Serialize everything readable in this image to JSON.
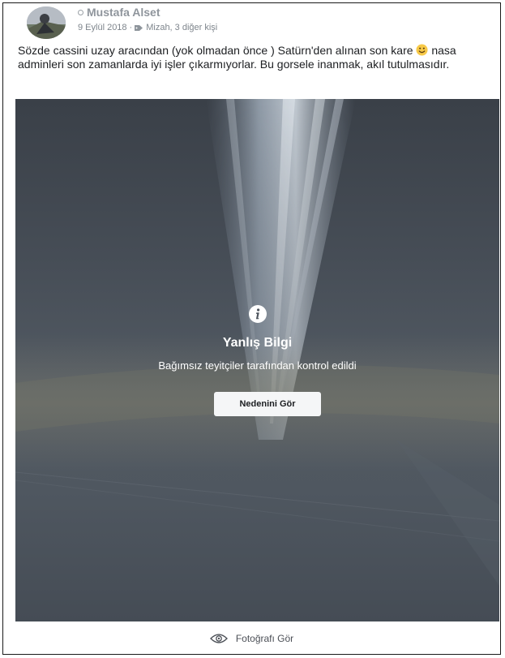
{
  "post": {
    "author": "Mustafa Alset",
    "date": "9 Eylül 2018",
    "separator": "·",
    "tags": "Mizah, 3 diğer kişi",
    "caption_part1": "Sözde cassini uzay aracından (yok olmadan önce ) Satürn'den alınan son kare",
    "caption_part2": "nasa adminleri son zamanlarda iyi işler çıkarmıyorlar. Bu gorsele inanmak, akıl tutulmasıdır."
  },
  "warning": {
    "title": "Yanlış Bilgi",
    "subtitle": "Bağımsız teyitçiler tarafından kontrol edildi",
    "button_label": "Nedenini Gör"
  },
  "footer": {
    "view_photo_label": "Fotoğrafı Gör"
  },
  "icons": {
    "privacy": "globe-icon",
    "tag": "tag-icon",
    "emoji": "smile-emoji-icon",
    "info": "info-icon",
    "eye": "eye-icon"
  },
  "colors": {
    "overlay_text": "#ffffff",
    "button_bg": "#f5f6f7",
    "author_text": "#8f959c",
    "photo_base": "#4b525b"
  }
}
